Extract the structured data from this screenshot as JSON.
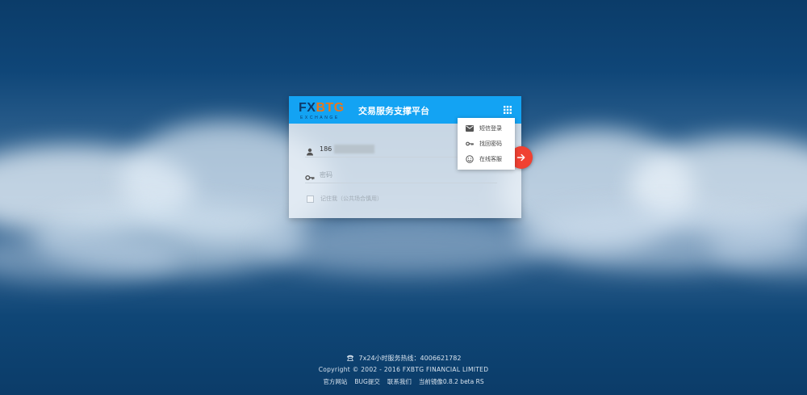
{
  "header": {
    "logo_main": "FX",
    "logo_accent": "BTG",
    "logo_sub": "EXCHANGE",
    "title": "交易服务支撑平台",
    "menu_icon": "grid-icon"
  },
  "form": {
    "username_value": "186",
    "username_icon": "person-icon",
    "password_placeholder": "密码",
    "password_icon": "key-icon",
    "remember_label": "记住我（公共场合慎用）",
    "submit_icon": "arrow-right-icon"
  },
  "menu": {
    "items": [
      {
        "label": "短信登录",
        "icon": "mail-icon"
      },
      {
        "label": "找回密码",
        "icon": "key-icon"
      },
      {
        "label": "在线客服",
        "icon": "smiley-icon"
      }
    ]
  },
  "footer": {
    "hotline": "7x24小时服务热线：4006621782",
    "hotline_icon": "phone-icon",
    "copyright": "Copyright © 2002 - 2016 FXBTG FINANCIAL LIMITED",
    "links": [
      "官方网站",
      "BUG提交",
      "联系我们",
      "当前镜像0.8.2 beta RS"
    ]
  },
  "colors": {
    "header_bg": "#13a3f3",
    "submit_bg": "#f04132",
    "logo_accent": "#e8781b",
    "page_bg": "#0b3f6d"
  }
}
